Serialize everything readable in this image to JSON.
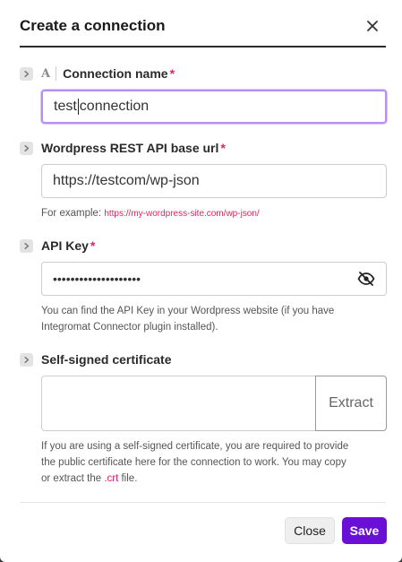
{
  "dialog": {
    "title": "Create a connection",
    "close_icon": "close-icon"
  },
  "fields": {
    "connection_name": {
      "label": "Connection name",
      "required_mark": "*",
      "value_before_caret": "test",
      "value_after_caret": "connection",
      "type_icon": "A"
    },
    "base_url": {
      "label": "Wordpress REST API base url",
      "required_mark": "*",
      "value": "https://testcom/wp-json",
      "hint_prefix": "For example: ",
      "hint_link": "https://my-wordpress-site.com/wp-json/"
    },
    "api_key": {
      "label": "API Key",
      "required_mark": "*",
      "masked_value": "••••••••••••••••••••",
      "hint_line1": "You can find the API Key in your Wordpress website (if you have",
      "hint_line2": "Integromat Connector plugin installed).",
      "toggle_icon": "eye-off-icon"
    },
    "certificate": {
      "label": "Self-signed certificate",
      "value": "",
      "extract_label": "Extract",
      "hint_line1": "If you are using a self-signed certificate, you are required to provide",
      "hint_line2": "the public certificate here for the connection to work. You may copy",
      "hint_line3_prefix": "or extract the ",
      "hint_line3_ext": ".crt",
      "hint_line3_suffix": " file."
    }
  },
  "footer": {
    "close_label": "Close",
    "save_label": "Save"
  },
  "colors": {
    "accent": "#6a0fd6",
    "required": "#e0245e",
    "focus_border": "#b68ff0"
  }
}
